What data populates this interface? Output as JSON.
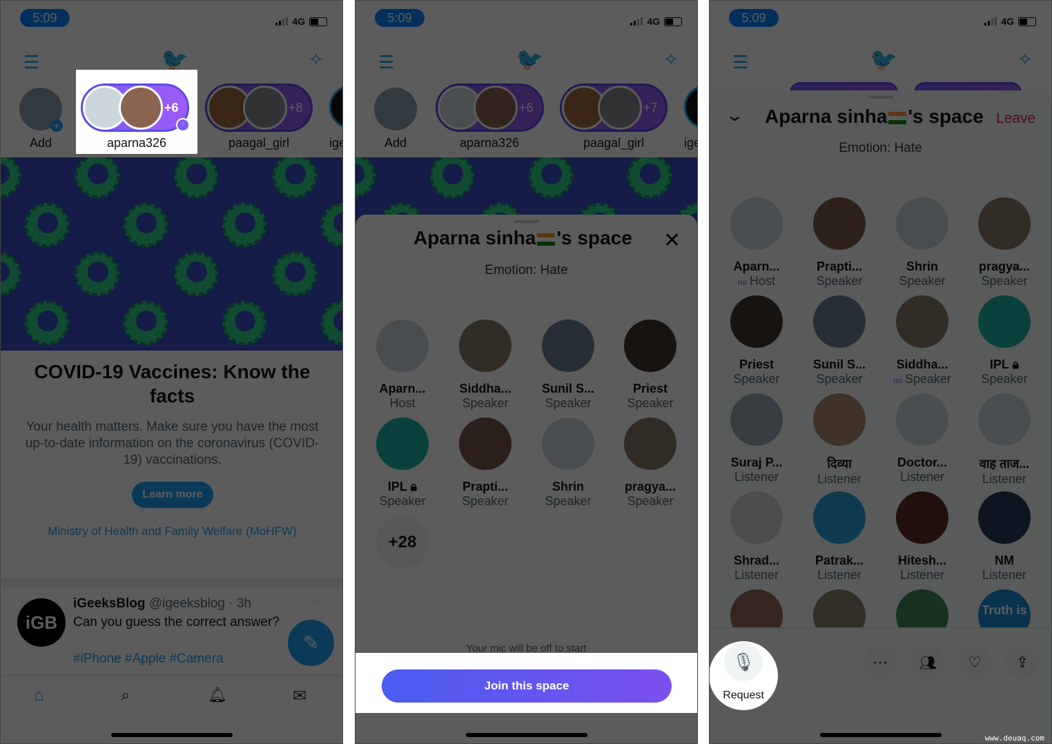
{
  "status": {
    "time": "5:09",
    "network": "4G"
  },
  "colors": {
    "twitter_blue": "#1da1f2",
    "spaces_purple": "#7c5cf5",
    "leave_red": "#e0245e",
    "join_gradient_start": "#4a5cf0",
    "join_gradient_end": "#7b4ff0"
  },
  "panel1": {
    "stories": [
      {
        "label": "Add"
      },
      {
        "label": "aparna326",
        "count": "+6"
      },
      {
        "label": "paagal_girl",
        "count": "+8"
      },
      {
        "label": "ige"
      }
    ],
    "card": {
      "title": "COVID-19 Vaccines: Know the facts",
      "body": "Your health matters. Make sure you have the most up-to-date information on the coronavirus (COVID-19) vaccinations.",
      "button": "Learn more",
      "link": "Ministry of Health and Family Welfare (MoHFW)"
    },
    "tweet": {
      "avatar_text": "iGB",
      "name": "iGeeksBlog",
      "handle": "@igeeksblog",
      "time": "· 3h",
      "text": "Can you guess the correct answer?",
      "hashtags": "#iPhone #Apple #Camera"
    },
    "tabs": [
      "home-icon",
      "search-icon",
      "bell-icon",
      "mail-icon"
    ]
  },
  "panel2": {
    "stories": [
      {
        "label": "Add"
      },
      {
        "label": "aparna326",
        "count": "+6"
      },
      {
        "label": "paagal_girl",
        "count": "+7"
      },
      {
        "label": "ige"
      }
    ],
    "space": {
      "title_name": "Aparna sinha",
      "title_suffix": "'s space",
      "topic": "Emotion: Hate",
      "participants": [
        {
          "name": "Aparn...",
          "role": "Host",
          "color": "#ccd6dd"
        },
        {
          "name": "Siddha...",
          "role": "Speaker",
          "color": "#8a7a6a"
        },
        {
          "name": "Sunil S...",
          "role": "Speaker",
          "color": "#6f7f92"
        },
        {
          "name": "Priest",
          "role": "Speaker",
          "color": "#3d3530"
        },
        {
          "name": "IPL",
          "role": "Speaker",
          "color": "#1fb5a8",
          "locked": true
        },
        {
          "name": "Prapti...",
          "role": "Speaker",
          "color": "#7a5a4e"
        },
        {
          "name": "Shrin",
          "role": "Speaker",
          "color": "#ccd6dd"
        },
        {
          "name": "pragya...",
          "role": "Speaker",
          "color": "#8b7a6c"
        }
      ],
      "more_count": "+28",
      "mic_note": "Your mic will be off to start",
      "join_button": "Join this space"
    }
  },
  "panel3": {
    "space": {
      "title_name": "Aparna sinha",
      "title_suffix": "'s space",
      "leave": "Leave",
      "topic": "Emotion: Hate",
      "participants": [
        {
          "name": "Aparn...",
          "role": "Host",
          "color": "#ccd6dd",
          "speaking": true
        },
        {
          "name": "Prapti...",
          "role": "Speaker",
          "color": "#7a5a4e"
        },
        {
          "name": "Shrin",
          "role": "Speaker",
          "color": "#ccd6dd"
        },
        {
          "name": "pragya...",
          "role": "Speaker",
          "color": "#8b7a6c"
        },
        {
          "name": "Priest",
          "role": "Speaker",
          "color": "#3d3530"
        },
        {
          "name": "Sunil S...",
          "role": "Speaker",
          "color": "#6f7f92"
        },
        {
          "name": "Siddha...",
          "role": "Speaker",
          "color": "#8a7a6a",
          "speaking": true
        },
        {
          "name": "IPL",
          "role": "Speaker",
          "color": "#1fb5a8",
          "locked": true
        },
        {
          "name": "Suraj P...",
          "role": "Listener",
          "color": "#9aa8b5"
        },
        {
          "name": "दिव्या",
          "role": "Listener",
          "color": "#b08a6a"
        },
        {
          "name": "Doctor...",
          "role": "Listener",
          "color": "#ccd6dd"
        },
        {
          "name": "वाह ताज...",
          "role": "Listener",
          "color": "#ccd6dd"
        },
        {
          "name": "Shrad...",
          "role": "Listener",
          "color": "#d8d2cc"
        },
        {
          "name": "Patrak...",
          "role": "Listener",
          "color": "#2ea0d8"
        },
        {
          "name": "Hitesh...",
          "role": "Listener",
          "color": "#5a2a22"
        },
        {
          "name": "NM",
          "role": "Listener",
          "color": "#2a3a5a"
        },
        {
          "name": "",
          "role": "",
          "color": "#9a6a5a"
        },
        {
          "name": "",
          "role": "",
          "color": "#8a8070"
        },
        {
          "name": "",
          "role": "",
          "color": "#3a8a5a"
        },
        {
          "name": "",
          "role": "",
          "color": "#1a8ad8",
          "avatar_text": "Truth is"
        }
      ],
      "request_label": "Request",
      "actions": [
        "more-icon",
        "people-icon",
        "heart-plus-icon",
        "share-icon"
      ]
    }
  },
  "watermark": "www.deuaq.com"
}
